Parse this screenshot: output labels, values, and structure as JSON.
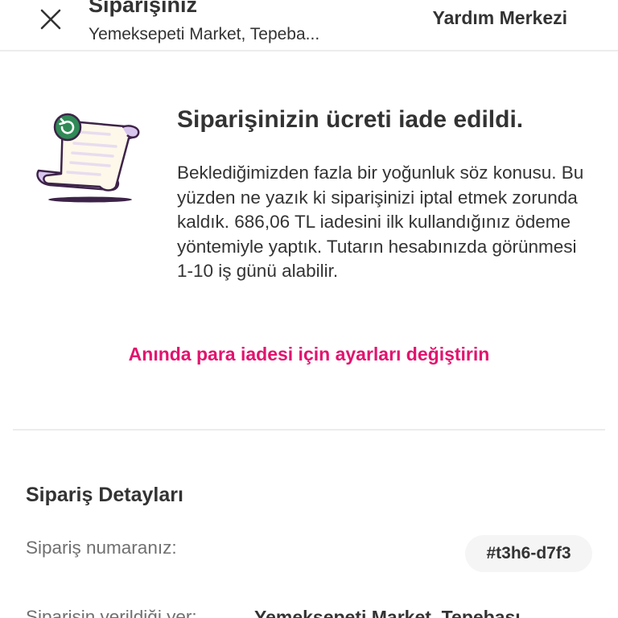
{
  "header": {
    "title": "Siparişiniz",
    "subtitle": "Yemeksepeti Market, Tepeba...",
    "help_label": "Yardım Merkezi",
    "close_icon": "close-icon"
  },
  "refund": {
    "illustration_icon": "refund-receipt-icon",
    "title": "Siparişinizin ücreti iade edildi.",
    "body": "Beklediğimizden fazla bir yoğunluk söz konusu. Bu yüzden ne yazık ki siparişinizi iptal etmek zorunda kaldık. 686,06 TL iadesini ilk kullandığınız ödeme yöntemiyle yaptık. Tutarın hesabınızda görünmesi 1-10 iş günü alabilir.",
    "instant_refund_link": "Anında para iadesi için ayarları değiştirin"
  },
  "details": {
    "title": "Sipariş Detayları",
    "order_number_label": "Sipariş numaranız:",
    "order_number": "#t3h6-d7f3",
    "ordered_from_label": "Siparişin verildiği yer:",
    "ordered_from": "Yemeksepeti Market, Tepebaşı"
  },
  "colors": {
    "accent": "#e2136e",
    "text": "#333333",
    "muted": "#707070",
    "divider": "#ececec",
    "illustration_purple": "#d9c6ee",
    "illustration_green": "#2f8a55"
  }
}
